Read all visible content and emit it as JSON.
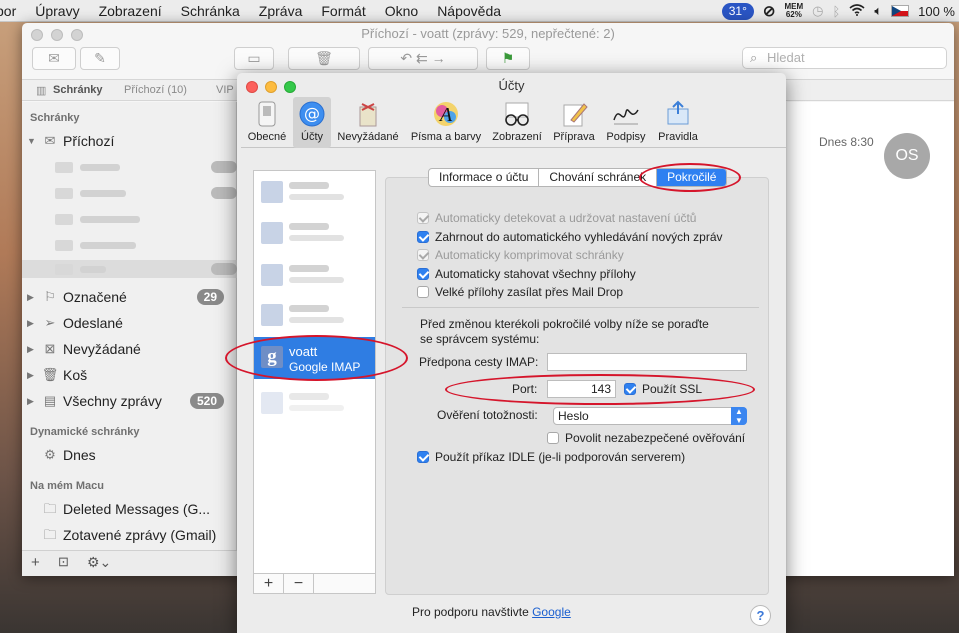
{
  "menubar": {
    "items": [
      "bor",
      "Úpravy",
      "Zobrazení",
      "Schránka",
      "Zpráva",
      "Formát",
      "Okno",
      "Nápověda"
    ],
    "temp": "31°",
    "mem_label": "MEM",
    "mem_value": "62%",
    "battery": "100 %"
  },
  "mail_window": {
    "title": "Příchozí - voatt (zprávy: 529, nepřečtené: 2)",
    "search_placeholder": "Hledat",
    "favorites": {
      "mailboxes": "Schránky",
      "inbox": "Příchozí (10)",
      "vip": "VIP"
    },
    "sidebar": {
      "section_mailboxes": "Schránky",
      "inbox_label": "Příchozí",
      "flagged": {
        "label": "Označené",
        "count": "29"
      },
      "sent": {
        "label": "Odeslané"
      },
      "junk": {
        "label": "Nevyžádané"
      },
      "trash": {
        "label": "Koš"
      },
      "all_mail": {
        "label": "Všechny zprávy",
        "count": "520"
      },
      "section_smart": "Dynamické schránky",
      "today": "Dnes",
      "section_on_mac": "Na mém Macu",
      "deleted": "Deleted Messages (G...",
      "recovered": "Zotavené zprávy (Gmail)"
    },
    "message": {
      "time": "Dnes 8:30",
      "avatar_initials": "OS"
    }
  },
  "accounts_dialog": {
    "title": "Účty",
    "toolbar": [
      "Obecné",
      "Účty",
      "Nevyžádané",
      "Písma a barvy",
      "Zobrazení",
      "Příprava",
      "Podpisy",
      "Pravidla"
    ],
    "selected_account": {
      "name": "voatt",
      "type": "Google IMAP"
    },
    "tabs": [
      "Informace o účtu",
      "Chování schránek",
      "Pokročilé"
    ],
    "active_tab": "Pokročilé",
    "checkboxes": [
      {
        "label": "Automaticky detekovat a udržovat nastavení účtů",
        "checked": true,
        "enabled": false
      },
      {
        "label": "Zahrnout do automatického vyhledávání nových zpráv",
        "checked": true,
        "enabled": true
      },
      {
        "label": "Automaticky komprimovat schránky",
        "checked": true,
        "enabled": false
      },
      {
        "label": "Automaticky stahovat všechny přílohy",
        "checked": true,
        "enabled": true
      },
      {
        "label": "Velké přílohy zasílat přes Mail Drop",
        "checked": false,
        "enabled": true
      }
    ],
    "warning_line1": "Před změnou kterékoli pokročilé volby níže se poraďte",
    "warning_line2": "se správcem systému:",
    "imap_prefix_label": "Předpona cesty IMAP:",
    "imap_prefix_value": "",
    "port_label": "Port:",
    "port_value": "143",
    "ssl_label": "Použít SSL",
    "auth_label": "Ověření totožnosti:",
    "auth_value": "Heslo",
    "insecure_label": "Povolit nezabezpečené ověřování",
    "idle_label": "Použít příkaz IDLE (je-li podporován serverem)",
    "support_text": "Pro podporu navštivte",
    "support_link": "Google",
    "help": "?",
    "add": "+",
    "remove": "−"
  },
  "colors": {
    "accent": "#2f7de3",
    "annotation": "#d5152b"
  }
}
